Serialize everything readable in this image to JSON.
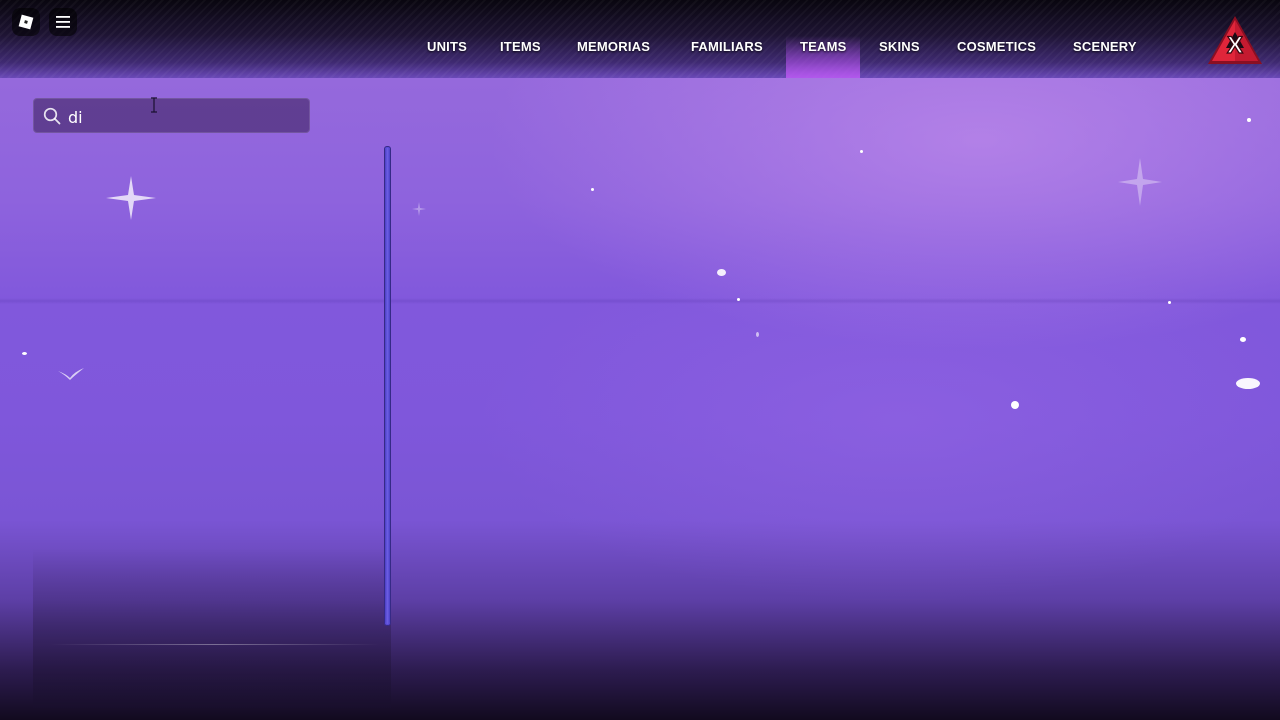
{
  "topbar": {
    "nav": [
      {
        "label": "UNITS"
      },
      {
        "label": "ITEMS"
      },
      {
        "label": "MEMORIAS"
      },
      {
        "label": "FAMILIARS"
      },
      {
        "label": "TEAMS",
        "active": true
      },
      {
        "label": "SKINS"
      },
      {
        "label": "COSMETICS"
      },
      {
        "label": "SCENERY"
      }
    ],
    "logo_text": "X",
    "icons": {
      "roblox": "roblox-logo-icon",
      "menu": "hamburger-menu-icon",
      "logo": "game-logo-icon"
    }
  },
  "search": {
    "value": "di",
    "icon": "search-icon"
  },
  "colors": {
    "accent_active_tab": "#b050eb",
    "scrollbar": "#5a4bd8",
    "logo_red": "#e0253a"
  }
}
